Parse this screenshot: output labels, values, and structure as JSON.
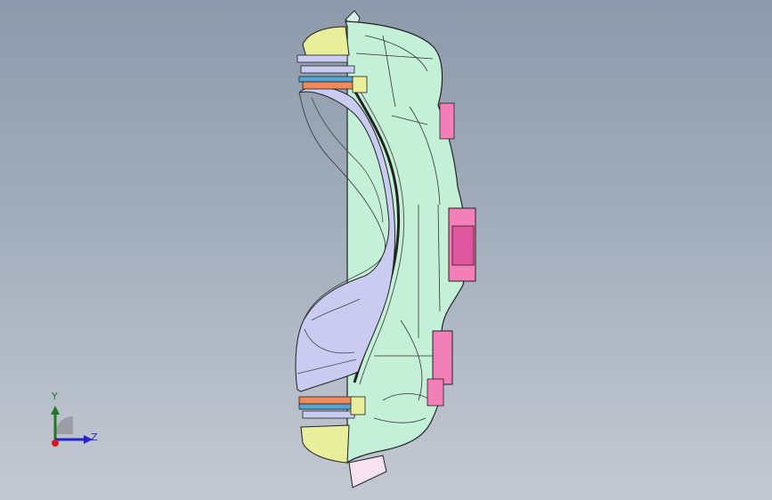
{
  "viewport": {
    "background_top": "#8d9aab",
    "background_bottom": "#c3c9d2"
  },
  "model": {
    "part_colors": {
      "shell": "#c4f0d8",
      "inner_surface": "#c9cbf0",
      "end_caps": "#e9ee9a",
      "brackets": "#f27fb8",
      "clamp_orange": "#f08a5a",
      "clamp_blue": "#54a6d8",
      "outline": "#222222"
    }
  },
  "triad": {
    "y_label": "Y",
    "z_label": "Z",
    "y_color": "#1f7a1f",
    "z_color": "#2424c8",
    "x_color": "#d41a1a"
  }
}
